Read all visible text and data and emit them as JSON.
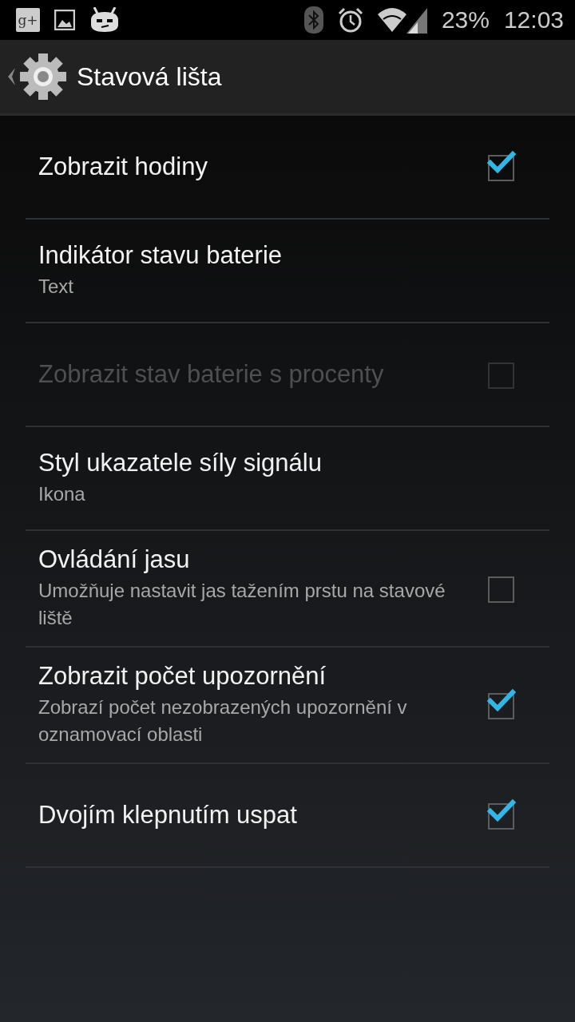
{
  "status_bar": {
    "app_badge": "g+",
    "battery": "23%",
    "time": "12:03"
  },
  "header": {
    "title": "Stavová lišta"
  },
  "items": [
    {
      "kind": "checkbox",
      "title": "Zobrazit hodiny",
      "checked": true,
      "disabled": false
    },
    {
      "kind": "plain",
      "title": "Indikátor stavu baterie",
      "summary": "Text",
      "disabled": false
    },
    {
      "kind": "checkbox",
      "title": "Zobrazit stav baterie s procenty",
      "checked": false,
      "disabled": true
    },
    {
      "kind": "plain",
      "title": "Styl ukazatele síly signálu",
      "summary": "Ikona",
      "disabled": false
    },
    {
      "kind": "checkbox",
      "title": "Ovládání jasu",
      "summary": "Umožňuje nastavit jas tažením prstu na stavové liště",
      "checked": false,
      "disabled": false
    },
    {
      "kind": "checkbox",
      "title": "Zobrazit počet upozornění",
      "summary": "Zobrazí počet nezobrazených upozornění v oznamovací oblasti",
      "checked": true,
      "disabled": false
    },
    {
      "kind": "checkbox",
      "title": "Dvojím klepnutím uspat",
      "checked": true,
      "disabled": false
    }
  ]
}
